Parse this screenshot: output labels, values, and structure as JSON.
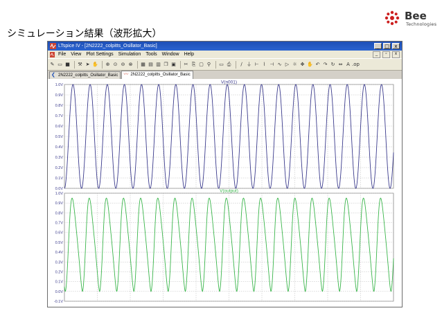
{
  "slide": {
    "title": "シミュレーション結果（波形拡大）",
    "logo_text": "Bee",
    "logo_sub": "Technologies"
  },
  "window": {
    "title": "LTspice IV - [2N2222_colpitts_Osillator_Basic]",
    "min_label": "_",
    "max_label": "□",
    "close_label": "x"
  },
  "menu": {
    "items": [
      {
        "label": "File"
      },
      {
        "label": "View"
      },
      {
        "label": "Plot Settings"
      },
      {
        "label": "Simulation"
      },
      {
        "label": "Tools"
      },
      {
        "label": "Window"
      },
      {
        "label": "Help"
      }
    ],
    "mdi": [
      "_",
      "▫",
      "x"
    ]
  },
  "tabs": [
    {
      "label": "2N2222_colpitts_Osillator_Basic",
      "icon": "schematic-icon"
    },
    {
      "label": "2N2222_colpitts_Osillator_Basic",
      "icon": "waveform-icon"
    }
  ],
  "colors": {
    "trace_top": "#3a3a8c",
    "trace_bottom": "#39b54a",
    "grid": "#b8b8b8",
    "axis_text": "#3a3a8c"
  },
  "chart_data": [
    {
      "type": "line",
      "title": "V(n001)",
      "y_ticks": [
        "1.0V",
        "0.9V",
        "0.8V",
        "0.7V",
        "0.6V",
        "0.5V",
        "0.4V",
        "0.3V",
        "0.2V",
        "0.1V",
        "0.0V"
      ],
      "ylim": [
        0.0,
        1.0
      ],
      "series": [
        {
          "name": "V(n001)",
          "waveform": "sine",
          "cycles": 19.2,
          "min": 0.0,
          "max": 1.0
        }
      ]
    },
    {
      "type": "line",
      "title": "V(output)",
      "y_ticks": [
        "1.0V",
        "0.9V",
        "0.8V",
        "0.7V",
        "0.6V",
        "0.5V",
        "0.4V",
        "0.3V",
        "0.2V",
        "0.1V",
        "0.0V",
        "-0.1V"
      ],
      "ylim": [
        -0.1,
        1.0
      ],
      "series": [
        {
          "name": "V(output)",
          "waveform": "distorted-sine",
          "cycles": 19.2,
          "min": 0.0,
          "max": 0.95
        }
      ]
    }
  ]
}
